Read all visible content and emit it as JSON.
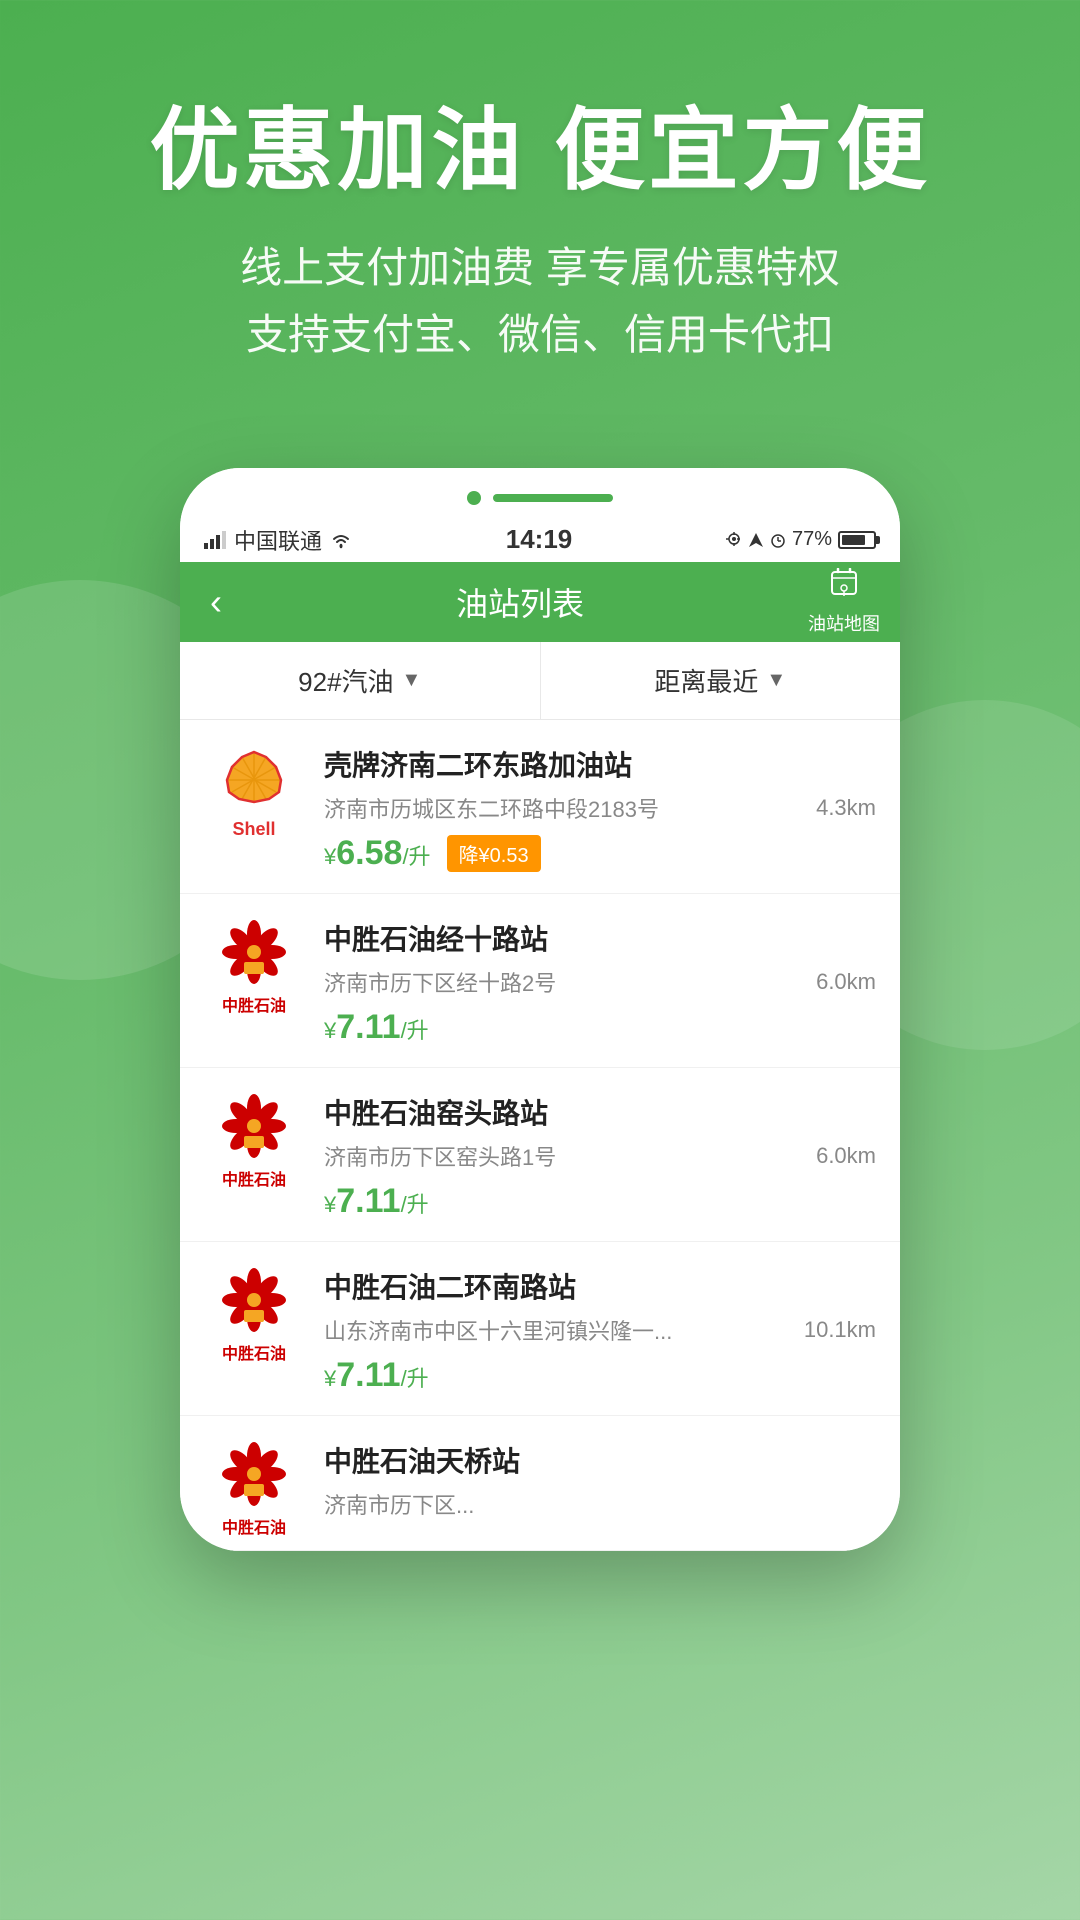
{
  "background": {
    "color_top": "#4caf50",
    "color_bottom": "#81c784"
  },
  "hero": {
    "title": "优惠加油 便宜方便",
    "subtitle_line1": "线上支付加油费 享专属优惠特权",
    "subtitle_line2": "支持支付宝、微信、信用卡代扣"
  },
  "phone": {
    "status_bar": {
      "carrier": "中国联通",
      "wifi_icon": "wifi",
      "time": "14:19",
      "location_icon": "location",
      "navigation_icon": "navigation",
      "alarm_icon": "alarm",
      "battery_percent": "77%"
    },
    "nav": {
      "back_label": "‹",
      "title": "油站列表",
      "map_button_label": "油站地图",
      "map_icon": "📍"
    },
    "filter": {
      "fuel_type": "92#汽油",
      "sort_by": "距离最近"
    },
    "stations": [
      {
        "brand": "Shell",
        "logo_type": "shell",
        "name": "壳牌济南二环东路加油站",
        "address": "济南市历城区东二环路中段2183号",
        "distance": "4.3km",
        "price": "6.58",
        "price_unit": "/升",
        "discount": "降¥0.53",
        "has_discount": true
      },
      {
        "brand": "中胜石油",
        "logo_type": "zhongsheng",
        "name": "中胜石油经十路站",
        "address": "济南市历下区经十路2号",
        "distance": "6.0km",
        "price": "7.11",
        "price_unit": "/升",
        "has_discount": false
      },
      {
        "brand": "中胜石油",
        "logo_type": "zhongsheng",
        "name": "中胜石油窑头路站",
        "address": "济南市历下区窑头路1号",
        "distance": "6.0km",
        "price": "7.11",
        "price_unit": "/升",
        "has_discount": false
      },
      {
        "brand": "中胜石油",
        "logo_type": "zhongsheng",
        "name": "中胜石油二环南路站",
        "address": "山东济南市中区十六里河镇兴隆一...",
        "distance": "10.1km",
        "price": "7.11",
        "price_unit": "/升",
        "has_discount": false
      },
      {
        "brand": "中胜石油",
        "logo_type": "zhongsheng",
        "name": "中胜石油天桥站",
        "address": "济南市历下区...",
        "distance": "",
        "price": "",
        "price_unit": "",
        "has_discount": false,
        "partial": true
      }
    ]
  }
}
